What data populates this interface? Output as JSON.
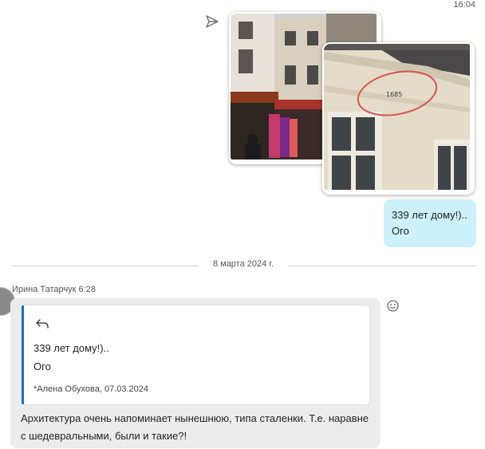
{
  "header": {
    "time": "16:04"
  },
  "outgoing": {
    "line1": "339 лет дому!)..",
    "line2": "Ого"
  },
  "divider": {
    "date": "8 марта 2024 г."
  },
  "incoming": {
    "sender": "Ирина Татарчук 6:28",
    "quote": {
      "line1": "339 лет дому!)..",
      "line2": "Ого",
      "source": "*Алена Обухова, 07.03.2024"
    },
    "text": "Архитектура очень напоминает нынешнюю, типа стaленки. Т.е. наравне с шедевральными, были и такие?!"
  },
  "photo2_mark": "1685",
  "icons": {
    "send": "send-icon",
    "reply": "reply-arrow-icon",
    "reaction": "smiley-icon"
  },
  "colors": {
    "outgoing_bubble": "#cdf1fb",
    "incoming_bubble": "#ececec",
    "quote_bar": "#1570c7"
  }
}
